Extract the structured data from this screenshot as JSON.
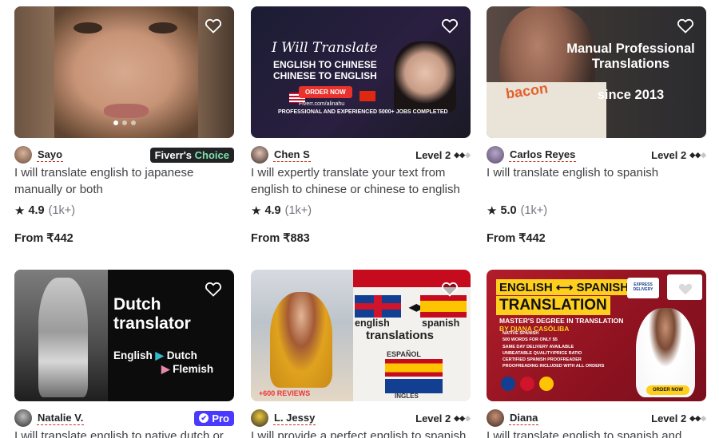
{
  "gigs": [
    {
      "seller": "Sayo",
      "badge_type": "fiverrs_choice",
      "badge_main": "Fiverr's",
      "badge_accent": "Choice",
      "title": "I will translate english to japanese manually or both",
      "rating": "4.9",
      "rating_count": "(1k+)",
      "price": "From ₹442",
      "image_dots": 3
    },
    {
      "seller": "Chen S",
      "badge_type": "level",
      "level": "Level 2",
      "title": "I will expertly translate your text from english to chinese or chinese to english",
      "rating": "4.9",
      "rating_count": "(1k+)",
      "price": "From ₹883",
      "image": {
        "script": "I Will Translate",
        "line1": "ENGLISH TO CHINESE",
        "line2": "CHINESE TO ENGLISH",
        "order": "ORDER NOW",
        "url": "Fiverr.com/alinahu",
        "footer": "PROFESSIONAL AND EXPERIENCED 5000+ JOBS COMPLETED"
      }
    },
    {
      "seller": "Carlos Reyes",
      "badge_type": "level",
      "level": "Level 2",
      "title": "I will translate english to spanish",
      "rating": "5.0",
      "rating_count": "(1k+)",
      "price": "From ₹442",
      "image": {
        "heading": "Manual Professional Translations",
        "since": "since 2013",
        "shirt": "bacon"
      }
    },
    {
      "seller": "Natalie V.",
      "badge_type": "pro",
      "badge_label": "Pro",
      "title": "I will translate english to native dutch or",
      "image": {
        "heading": "Dutch translator",
        "from": "English",
        "to1": "Dutch",
        "to2": "Flemish"
      }
    },
    {
      "seller": "L. Jessy",
      "badge_type": "level",
      "level": "Level 2",
      "title": "I will provide a perfect english to spanish",
      "image": {
        "w1": "english",
        "w2": "spanish",
        "w3": "translations",
        "espanol": "ESPAÑOL",
        "ingles": "INGLES",
        "reviews": "+600 REVIEWS"
      }
    },
    {
      "seller": "Diana",
      "badge_type": "level",
      "level": "Level 2",
      "title": "I will translate english to spanish and",
      "image": {
        "bar1": "ENGLISH ⟷ SPANISH",
        "bar2": "TRANSLATION",
        "sub_main": "MASTER'S DEGREE IN TRANSLATION",
        "sub_by": "BY DIANA CASÓLIBA",
        "list": [
          "NATIVE SPANISH",
          "500 WORDS FOR ONLY $5",
          "SAME DAY DELIVERY AVAILABLE",
          "UNBEATABLE QUALITY/PRICE RATIO",
          "CERTIFIED SPANISH PROOFREADER",
          "PROOFREADING INCLUDED WITH ALL ORDERS"
        ],
        "express": "EXPRESS DELIVERY",
        "order": "ORDER NOW"
      }
    }
  ],
  "icons": {
    "favorite": "heart-outline-icon",
    "rating": "star-icon",
    "level": "diamond-icon"
  }
}
